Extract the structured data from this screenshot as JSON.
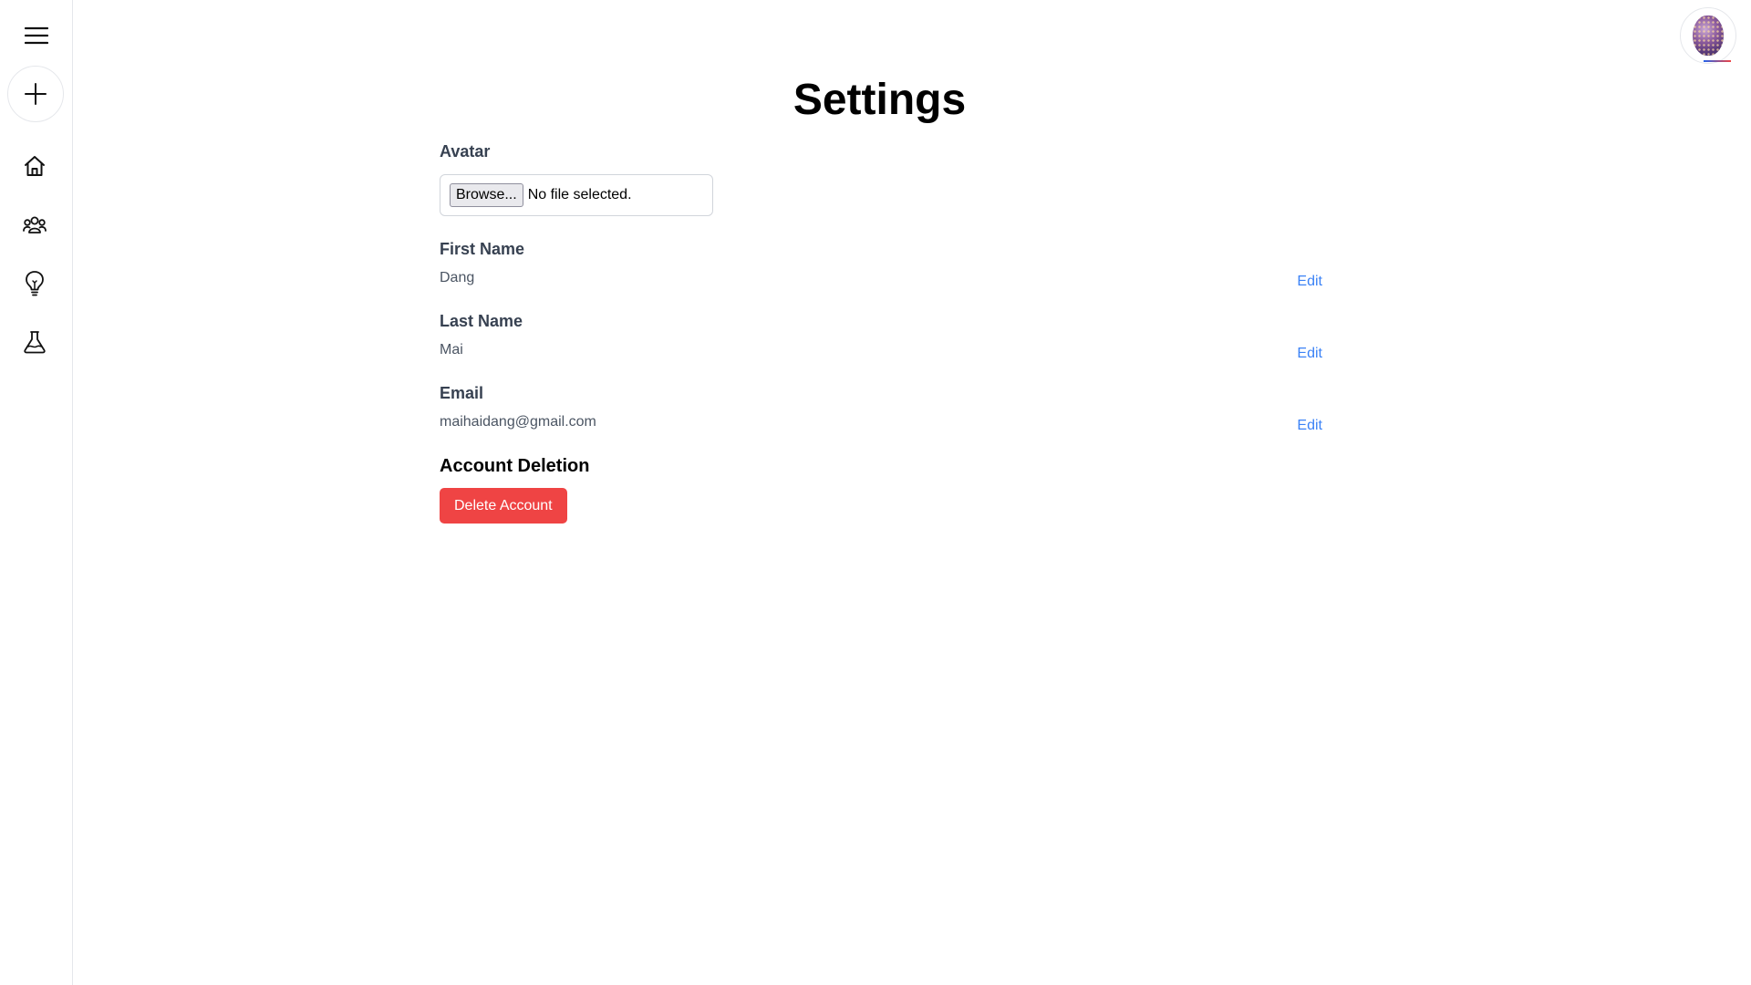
{
  "sidebar": {
    "icons": [
      "menu-icon",
      "plus-icon",
      "home-icon",
      "community-icon",
      "lightbulb-icon",
      "flask-icon"
    ]
  },
  "header": {
    "avatar_icon": "user-avatar"
  },
  "page": {
    "title": "Settings"
  },
  "avatar_field": {
    "label": "Avatar",
    "browse_label": "Browse...",
    "file_status": "No file selected."
  },
  "fields": {
    "first_name": {
      "label": "First Name",
      "value": "Dang",
      "edit_label": "Edit"
    },
    "last_name": {
      "label": "Last Name",
      "value": "Mai",
      "edit_label": "Edit"
    },
    "email": {
      "label": "Email",
      "value": "maihaidang@gmail.com",
      "edit_label": "Edit"
    }
  },
  "account_deletion": {
    "heading": "Account Deletion",
    "button_label": "Delete Account"
  },
  "colors": {
    "delete": "#ef4444",
    "link": "#3b82f6"
  }
}
